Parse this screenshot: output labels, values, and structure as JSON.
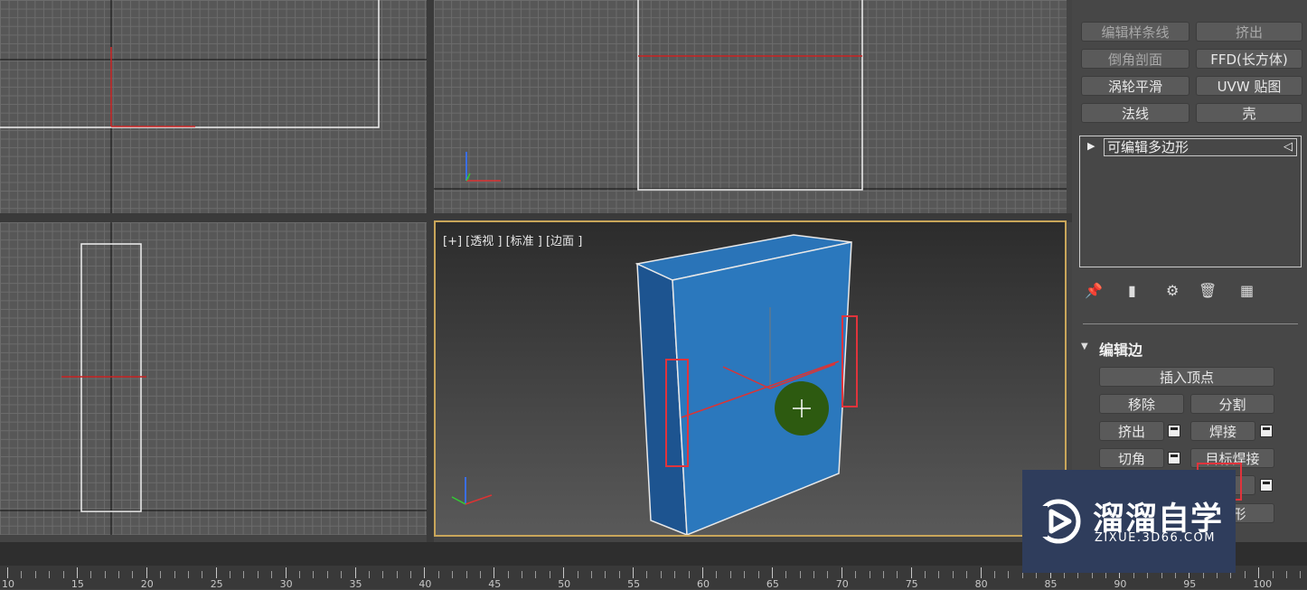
{
  "viewports": {
    "perspective": {
      "label": "[+] [透视 ] [标准 ] [边面 ]"
    }
  },
  "modifier_list": {
    "buttons": [
      "编辑样条线",
      "挤出",
      "倒角剖面",
      "FFD(长方体)",
      "涡轮平滑",
      "UVW 贴图",
      "法线",
      "壳"
    ]
  },
  "stack": {
    "item": "可编辑多边形"
  },
  "edit_edges": {
    "title": "编辑边",
    "insert_vertex": "插入顶点",
    "remove": "移除",
    "split": "分割",
    "extrude": "挤出",
    "weld": "焊接",
    "chamfer": "切角",
    "target_weld": "目标焊接",
    "create_shape_partial": "图形"
  },
  "timeline": {
    "ticks": [
      "10",
      "15",
      "20",
      "25",
      "30",
      "35",
      "40",
      "45",
      "50",
      "55",
      "60",
      "65",
      "70",
      "75",
      "80",
      "85",
      "90",
      "95",
      "100"
    ]
  },
  "watermark": {
    "main": "溜溜自学",
    "sub": "ZIXUE.3D66.COM"
  },
  "colors": {
    "box_front": "#2a74b8",
    "box_side": "#1d5490",
    "highlight": "#e0343c",
    "active_border": "#c9a65a"
  }
}
